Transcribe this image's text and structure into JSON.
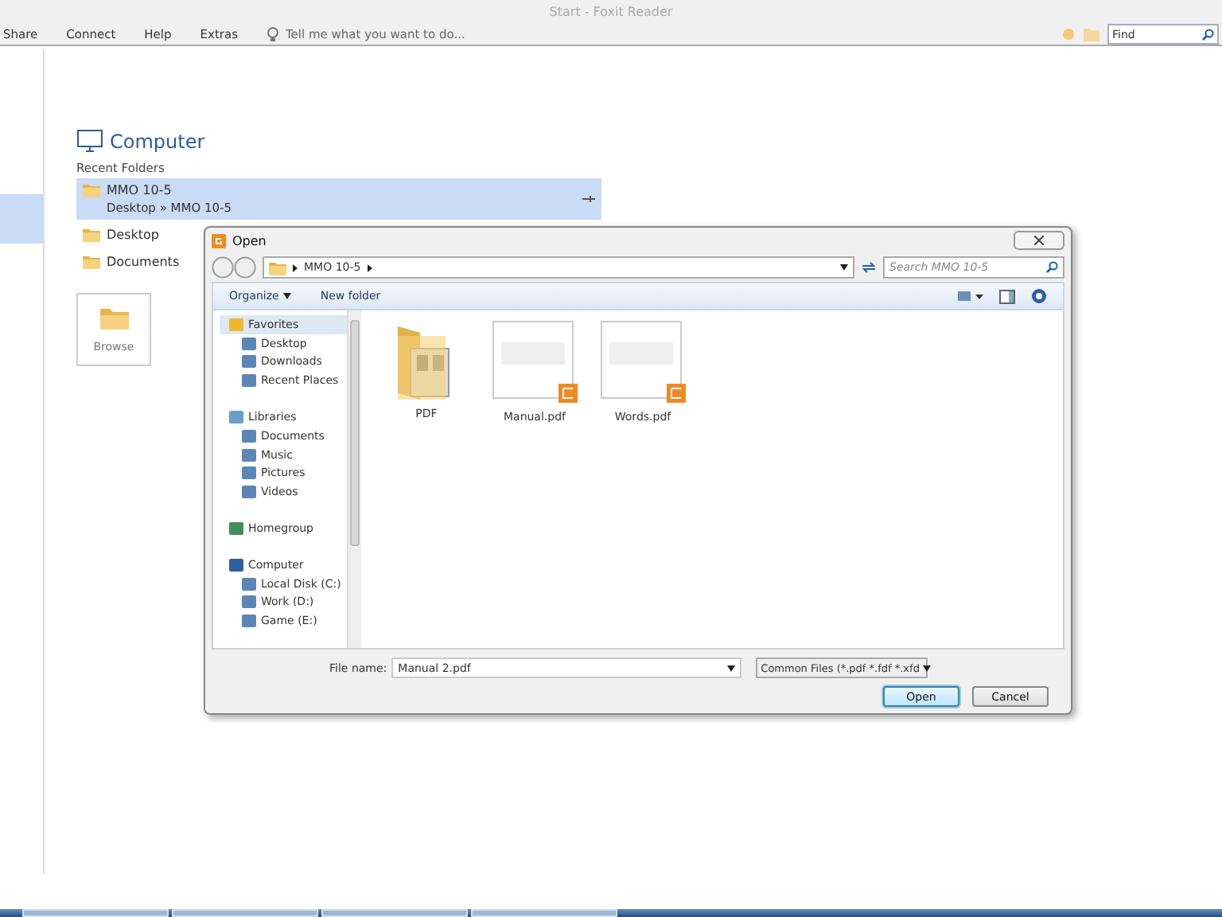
{
  "window": {
    "title": "Start - Foxit Reader"
  },
  "menu": [
    "Share",
    "Connect",
    "Help",
    "Extras"
  ],
  "tell_me": {
    "placeholder": "Tell me what you want to do..."
  },
  "find": {
    "placeholder": "Find"
  },
  "heading": "Computer",
  "recent_label": "Recent Folders",
  "folders": [
    {
      "name": "MMO 10-5",
      "path": "Desktop » MMO 10-5",
      "selected": true
    },
    {
      "name": "Desktop",
      "selected": false
    },
    {
      "name": "Documents",
      "selected": false
    }
  ],
  "browse": "Browse",
  "dialog": {
    "title": "Open",
    "breadcrumb": [
      "MMO 10-5"
    ],
    "search": {
      "placeholder": "Search MMO 10-5"
    },
    "toolbar": [
      {
        "label": "Organize",
        "kind": "menu"
      },
      {
        "label": "New folder",
        "kind": "button"
      }
    ],
    "nav": [
      {
        "label": "Favorites",
        "selected": true,
        "children": [
          {
            "label": "Desktop"
          },
          {
            "label": "Downloads"
          },
          {
            "label": "Recent Places"
          }
        ]
      },
      {
        "label": "Libraries",
        "selected": false,
        "children": [
          {
            "label": "Documents"
          },
          {
            "label": "Music"
          },
          {
            "label": "Pictures"
          },
          {
            "label": "Videos"
          }
        ]
      },
      {
        "label": "Homegroup",
        "selected": false
      },
      {
        "label": "Computer",
        "selected": false,
        "children": [
          {
            "label": "Local Disk (C:)"
          },
          {
            "label": "Work (D:)"
          },
          {
            "label": "Game (E:)"
          }
        ]
      }
    ],
    "files": [
      {
        "name": "PDF",
        "kind": "folder"
      },
      {
        "name": "Manual.pdf",
        "kind": "pdf"
      },
      {
        "name": "Words.pdf",
        "kind": "pdf"
      }
    ],
    "file_name_label": "File name:",
    "file_name": "Manual 2.pdf",
    "file_type": "Common Files (*.pdf *.fdf *.xfd",
    "buttons": [
      {
        "label": "Open",
        "default": true
      },
      {
        "label": "Cancel",
        "default": false
      }
    ]
  }
}
